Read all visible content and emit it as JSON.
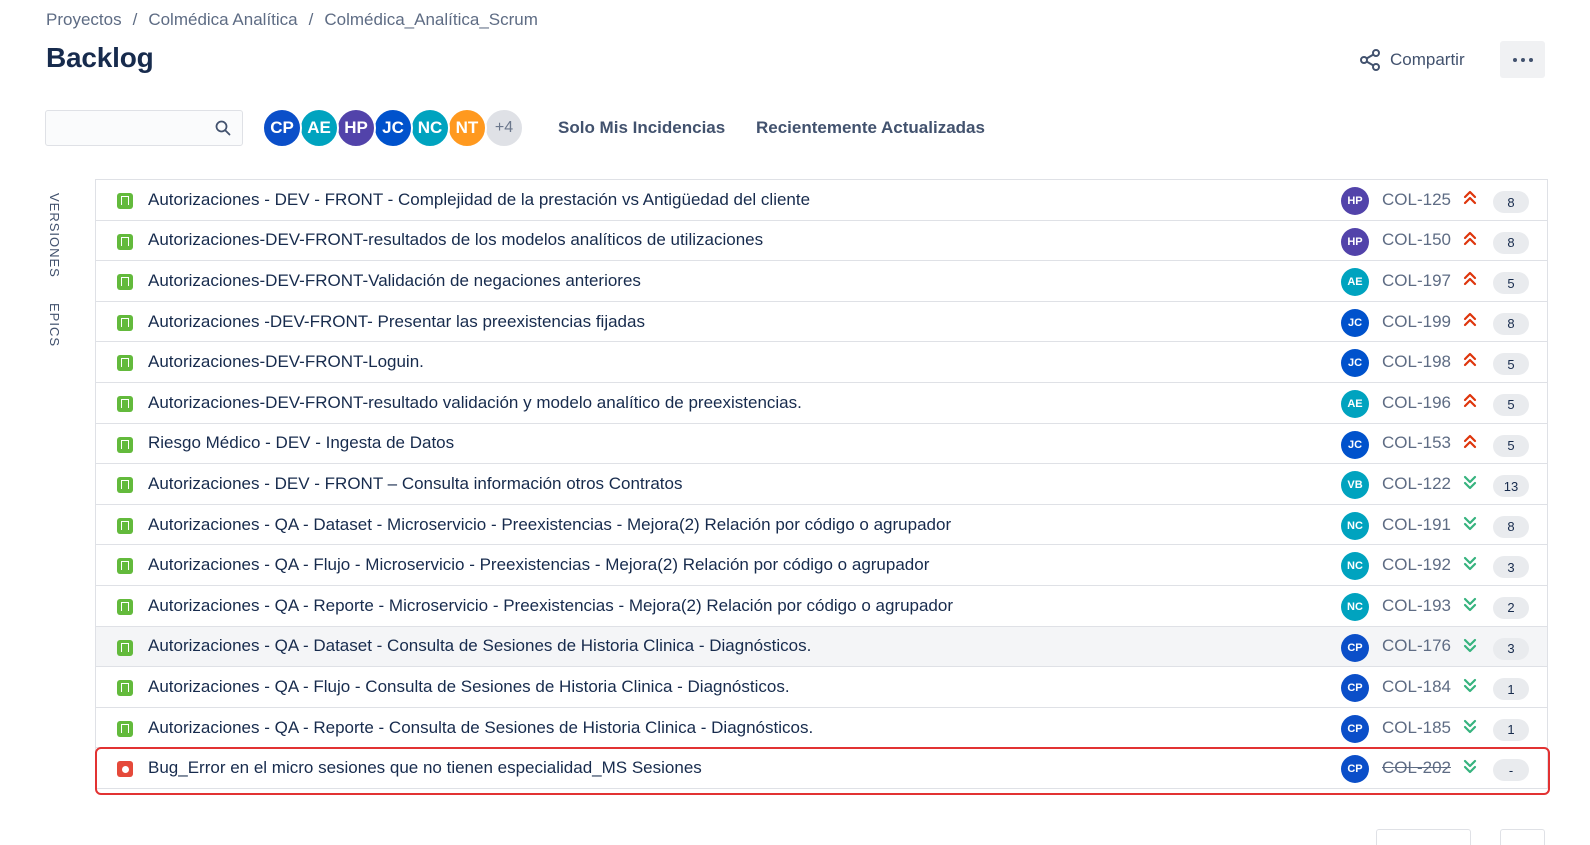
{
  "breadcrumb": [
    "Proyectos",
    "Colmédica Analítica",
    "Colmédica_Analítica_Scrum"
  ],
  "breadcrumb_separator": "/",
  "page_title": "Backlog",
  "header": {
    "share_label": "Compartir",
    "more_icon": "ellipsis-icon"
  },
  "search": {
    "value": "",
    "placeholder": "",
    "icon": "search-icon"
  },
  "avatars": [
    {
      "initials": "CP",
      "color": "#0b4fc9"
    },
    {
      "initials": "AE",
      "color": "#00a3bf"
    },
    {
      "initials": "HP",
      "color": "#5243aa"
    },
    {
      "initials": "JC",
      "color": "#0052cc"
    },
    {
      "initials": "NC",
      "color": "#00a3bf"
    },
    {
      "initials": "NT",
      "color": "#ff991f"
    }
  ],
  "avatars_more": "+4",
  "filters": [
    "Solo Mis Incidencias",
    "Recientemente Actualizadas"
  ],
  "sidebar_tabs": [
    "VERSIONES",
    "EPICS"
  ],
  "colors": {
    "story": "#63ba3c",
    "bug": "#e5493a",
    "priority_high": "#de350b",
    "priority_low": "#36b37e",
    "highlight": "#e23232"
  },
  "issues": [
    {
      "type": "story",
      "summary": "Autorizaciones - DEV - FRONT - Complejidad de la prestación vs Antigüedad del cliente",
      "assignee": "HP",
      "assignee_color": "#5243aa",
      "key": "COL-125",
      "priority": "highest",
      "points": "8"
    },
    {
      "type": "story",
      "summary": "Autorizaciones-DEV-FRONT-resultados de los modelos analíticos de utilizaciones",
      "assignee": "HP",
      "assignee_color": "#5243aa",
      "key": "COL-150",
      "priority": "highest",
      "points": "8"
    },
    {
      "type": "story",
      "summary": "Autorizaciones-DEV-FRONT-Validación de negaciones anteriores",
      "assignee": "AE",
      "assignee_color": "#00a3bf",
      "key": "COL-197",
      "priority": "highest",
      "points": "5"
    },
    {
      "type": "story",
      "summary": "Autorizaciones -DEV-FRONT- Presentar las preexistencias fijadas",
      "assignee": "JC",
      "assignee_color": "#0052cc",
      "key": "COL-199",
      "priority": "highest",
      "points": "8"
    },
    {
      "type": "story",
      "summary": "Autorizaciones-DEV-FRONT-Loguin.",
      "assignee": "JC",
      "assignee_color": "#0052cc",
      "key": "COL-198",
      "priority": "highest",
      "points": "5"
    },
    {
      "type": "story",
      "summary": "Autorizaciones-DEV-FRONT-resultado validación y modelo analítico de preexistencias.",
      "assignee": "AE",
      "assignee_color": "#00a3bf",
      "key": "COL-196",
      "priority": "highest",
      "points": "5"
    },
    {
      "type": "story",
      "summary": "Riesgo Médico - DEV - Ingesta de Datos",
      "assignee": "JC",
      "assignee_color": "#0052cc",
      "key": "COL-153",
      "priority": "highest",
      "points": "5"
    },
    {
      "type": "story",
      "summary": "Autorizaciones - DEV - FRONT – Consulta información otros Contratos",
      "assignee": "VB",
      "assignee_color": "#00a3bf",
      "key": "COL-122",
      "priority": "lowest",
      "points": "13"
    },
    {
      "type": "story",
      "summary": "Autorizaciones - QA - Dataset - Microservicio - Preexistencias - Mejora(2) Relación por código o agrupador",
      "assignee": "NC",
      "assignee_color": "#00a3bf",
      "key": "COL-191",
      "priority": "lowest",
      "points": "8"
    },
    {
      "type": "story",
      "summary": "Autorizaciones - QA - Flujo - Microservicio - Preexistencias - Mejora(2) Relación por código o agrupador",
      "assignee": "NC",
      "assignee_color": "#00a3bf",
      "key": "COL-192",
      "priority": "lowest",
      "points": "3"
    },
    {
      "type": "story",
      "summary": "Autorizaciones - QA - Reporte - Microservicio - Preexistencias - Mejora(2) Relación por código o agrupador",
      "assignee": "NC",
      "assignee_color": "#00a3bf",
      "key": "COL-193",
      "priority": "lowest",
      "points": "2"
    },
    {
      "type": "story",
      "summary": "Autorizaciones - QA - Dataset - Consulta de Sesiones de Historia Clinica - Diagnósticos.",
      "assignee": "CP",
      "assignee_color": "#0b4fc9",
      "key": "COL-176",
      "priority": "lowest",
      "points": "3",
      "hover": true
    },
    {
      "type": "story",
      "summary": "Autorizaciones - QA - Flujo - Consulta de Sesiones de Historia Clinica - Diagnósticos.",
      "assignee": "CP",
      "assignee_color": "#0b4fc9",
      "key": "COL-184",
      "priority": "lowest",
      "points": "1"
    },
    {
      "type": "story",
      "summary": "Autorizaciones - QA - Reporte - Consulta de Sesiones de Historia Clinica - Diagnósticos.",
      "assignee": "CP",
      "assignee_color": "#0b4fc9",
      "key": "COL-185",
      "priority": "lowest",
      "points": "1"
    },
    {
      "type": "bug",
      "summary": "Bug_Error en el micro sesiones que no tienen especialidad_MS Sesiones",
      "assignee": "CP",
      "assignee_color": "#0b4fc9",
      "key": "COL-202",
      "priority": "lowest",
      "points": "-",
      "resolved": true
    }
  ]
}
